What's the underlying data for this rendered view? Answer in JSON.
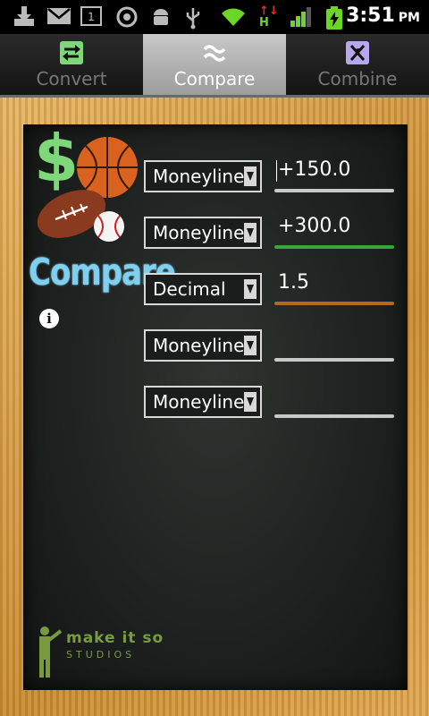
{
  "status_bar": {
    "time": "3:51",
    "ampm": "PM",
    "icons": [
      "download-icon",
      "gmail-icon",
      "calendar-icon",
      "sync-icon",
      "android-icon",
      "usb-icon",
      "wifi-icon",
      "data-icon",
      "signal-icon",
      "battery-icon"
    ],
    "calendar_day": "1"
  },
  "tabs": [
    {
      "label": "Convert",
      "icon": "convert-icon",
      "active": false
    },
    {
      "label": "Compare",
      "icon": "approx-icon",
      "active": true
    },
    {
      "label": "Combine",
      "icon": "combine-icon",
      "active": false
    }
  ],
  "app": {
    "title": "Compare",
    "dollar": "$"
  },
  "rows": [
    {
      "format": "Moneyline",
      "value": "+150.0",
      "underline": "#c8c8c8",
      "focused": true
    },
    {
      "format": "Moneyline",
      "value": "+300.0",
      "underline": "#3aa63a",
      "focused": false
    },
    {
      "format": "Decimal",
      "value": "1.5",
      "underline": "#b36a1f",
      "focused": false
    },
    {
      "format": "Moneyline",
      "value": "",
      "underline": "#c8c8c8",
      "focused": false
    },
    {
      "format": "Moneyline",
      "value": "",
      "underline": "#c8c8c8",
      "focused": false
    }
  ],
  "studio": {
    "brand": "make it so",
    "sub": "STUDIOS"
  },
  "colors": {
    "accent_green": "#7ed87a",
    "title_blue": "#7fd0f0",
    "board": "#1e2220",
    "frame": "#d9a24e"
  }
}
